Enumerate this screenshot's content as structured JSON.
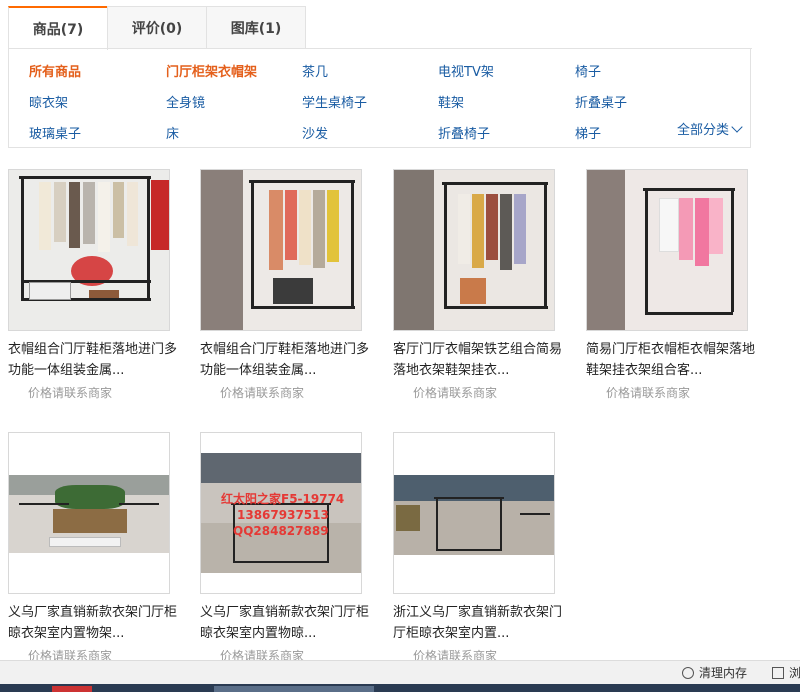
{
  "tabs": [
    {
      "label": "商品(7)",
      "active": true
    },
    {
      "label": "评价(0)",
      "active": false
    },
    {
      "label": "图库(1)",
      "active": false
    }
  ],
  "categories": [
    {
      "label": "所有商品",
      "highlight": true
    },
    {
      "label": "门厅柜架衣帽架",
      "highlight": true
    },
    {
      "label": "茶几"
    },
    {
      "label": "电视TV架"
    },
    {
      "label": "椅子"
    },
    {
      "label": "晾衣架"
    },
    {
      "label": "全身镜"
    },
    {
      "label": "学生桌椅子"
    },
    {
      "label": "鞋架"
    },
    {
      "label": "折叠桌子"
    },
    {
      "label": "玻璃桌子"
    },
    {
      "label": "床"
    },
    {
      "label": "沙发"
    },
    {
      "label": "折叠椅子"
    },
    {
      "label": "梯子"
    }
  ],
  "all_categories": "全部分类",
  "products": [
    {
      "title1": "衣帽组合门厅鞋柜落地进门多",
      "title2": "功能一体组装金属...",
      "price": "价格请联系商家"
    },
    {
      "title1": "衣帽组合门厅鞋柜落地进门多",
      "title2": "功能一体组装金属...",
      "price": "价格请联系商家"
    },
    {
      "title1": "客厅门厅衣帽架铁艺组合简易",
      "title2": "落地衣架鞋架挂衣...",
      "price": "价格请联系商家"
    },
    {
      "title1": "简易门厅柜衣帽柜衣帽架落地",
      "title2": "鞋架挂衣架组合客...",
      "price": "价格请联系商家"
    },
    {
      "title1": "义乌厂家直销新款衣架门厅柜",
      "title2": "晾衣架室内置物架...",
      "price": "价格请联系商家"
    },
    {
      "title1": "义乌厂家直销新款衣架门厅柜",
      "title2": "晾衣架室内置物晾...",
      "price": "价格请联系商家"
    },
    {
      "title1": "浙江义乌厂家直销新款衣架门",
      "title2": "厅柜晾衣架室内置...",
      "price": "价格请联系商家"
    }
  ],
  "image_text": {
    "p6_line1": "红太阳之家F5-19774",
    "p6_line2": "13867937513",
    "p6_line3": "QQ284827889"
  },
  "status_bar": {
    "clear_memory": "清理内存",
    "right_item": "浏"
  },
  "colors": {
    "accent": "#ff6a00",
    "link": "#1a5ca3",
    "highlight": "#e4601c"
  }
}
